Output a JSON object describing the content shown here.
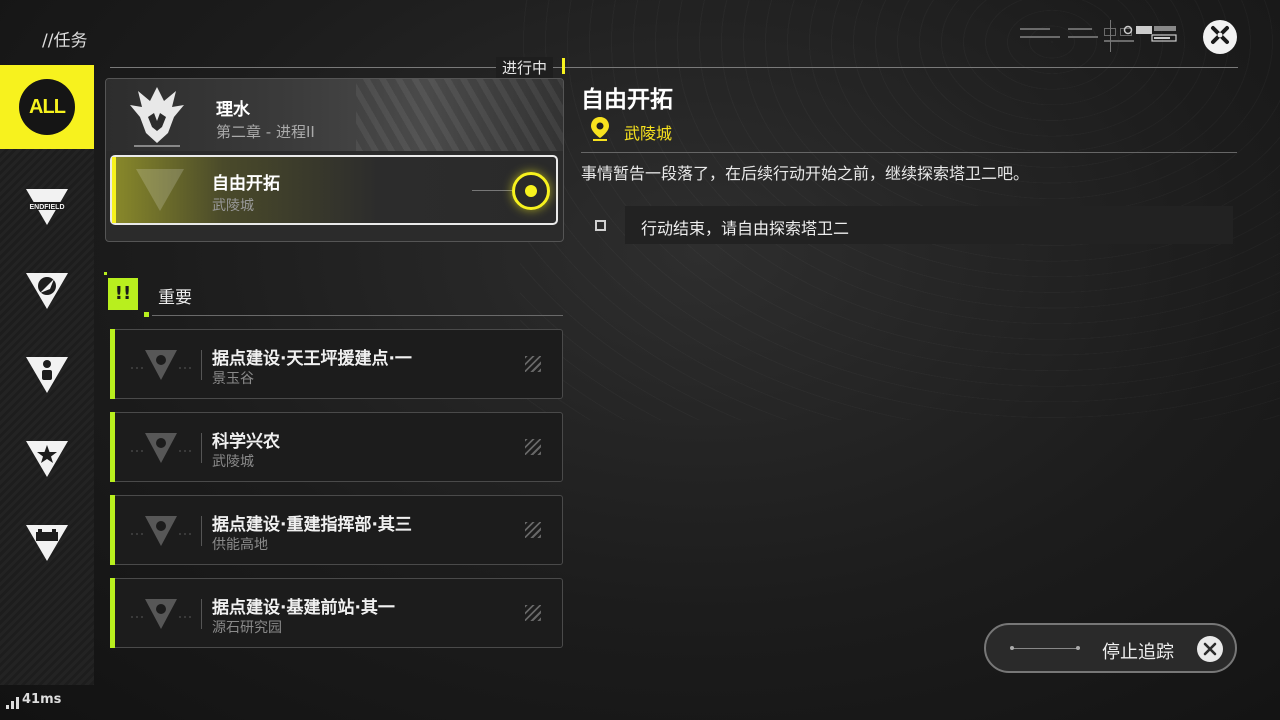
{
  "header": {
    "title": "//任务",
    "close_icon": "close-icon"
  },
  "sidebar": {
    "items": [
      {
        "label": "ALL",
        "icon": "all-icon",
        "active": true
      },
      {
        "label": "ENDFIELD",
        "icon": "endfield-icon"
      },
      {
        "label": "",
        "icon": "compass-icon"
      },
      {
        "label": "",
        "icon": "person-icon"
      },
      {
        "label": "",
        "icon": "star-icon"
      },
      {
        "label": "",
        "icon": "battery-icon"
      }
    ]
  },
  "in_progress": {
    "label": "进行中",
    "chapter": {
      "name": "理水",
      "subtitle": "第二章 - 进程II"
    },
    "selected_quest": {
      "name": "自由开拓",
      "location": "武陵城"
    }
  },
  "important": {
    "label": "重要",
    "icon_text": "!!",
    "quests": [
      {
        "name": "据点建设·天王坪援建点·一",
        "location": "景玉谷"
      },
      {
        "name": "科学兴农",
        "location": "武陵城"
      },
      {
        "name": "据点建设·重建指挥部·其三",
        "location": "供能高地"
      },
      {
        "name": "据点建设·基建前站·其一",
        "location": "源石研究园"
      }
    ]
  },
  "detail": {
    "title": "自由开拓",
    "location": "武陵城",
    "description": "事情暂告一段落了，在后续行动开始之前，继续探索塔卫二吧。",
    "objective": "行动结束，请自由探索塔卫二"
  },
  "stop_tracking": {
    "label": "停止追踪"
  },
  "status": {
    "ping": "41ms"
  },
  "colors": {
    "accent_yellow": "#f7f21e",
    "accent_green": "#b8ef1e",
    "location_yellow": "#f7e21e"
  }
}
